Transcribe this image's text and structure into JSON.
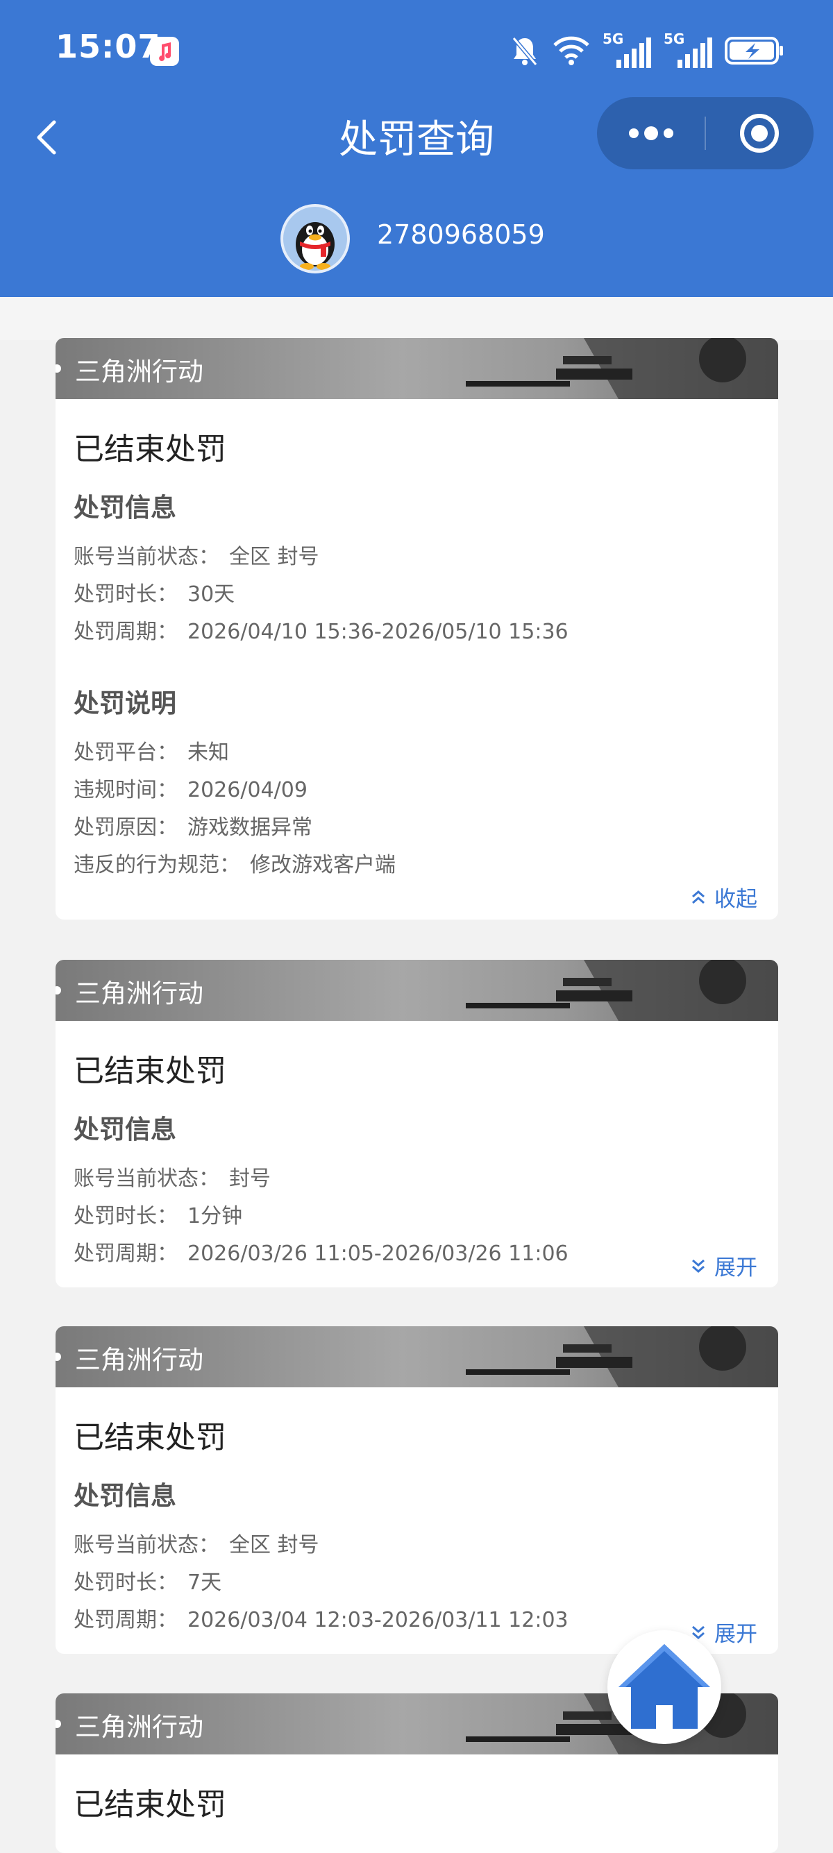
{
  "status_bar": {
    "time": "15:07",
    "network_1": "5G",
    "network_2": "5G"
  },
  "nav": {
    "title": "处罚查询"
  },
  "user": {
    "qq_number": "2780968059"
  },
  "colors": {
    "primary": "#3b78d4",
    "capsule": "#2d61ae",
    "background": "#f2f2f2",
    "card": "#ffffff"
  },
  "records": [
    {
      "game": "三角洲行动",
      "status": "已结束处罚",
      "info_title": "处罚信息",
      "info": [
        {
          "label": "账号当前状态：",
          "value": "全区 封号"
        },
        {
          "label": "处罚时长：",
          "value": "30天"
        },
        {
          "label": "处罚周期：",
          "value": "2026/04/10 15:36-2026/05/10 15:36"
        }
      ],
      "detail_title": "处罚说明",
      "details": [
        {
          "label": "处罚平台：",
          "value": "未知"
        },
        {
          "label": "违规时间：",
          "value": "2026/04/09"
        },
        {
          "label": "处罚原因：",
          "value": "游戏数据异常"
        },
        {
          "label": "违反的行为规范：",
          "value": "修改游戏客户端"
        }
      ],
      "toggle_label": "收起"
    },
    {
      "game": "三角洲行动",
      "status": "已结束处罚",
      "info_title": "处罚信息",
      "info": [
        {
          "label": "账号当前状态：",
          "value": "封号"
        },
        {
          "label": "处罚时长：",
          "value": "1分钟"
        },
        {
          "label": "处罚周期：",
          "value": "2026/03/26 11:05-2026/03/26 11:06"
        }
      ],
      "toggle_label": "展开"
    },
    {
      "game": "三角洲行动",
      "status": "已结束处罚",
      "info_title": "处罚信息",
      "info": [
        {
          "label": "账号当前状态：",
          "value": "全区 封号"
        },
        {
          "label": "处罚时长：",
          "value": "7天"
        },
        {
          "label": "处罚周期：",
          "value": "2026/03/04 12:03-2026/03/11 12:03"
        }
      ],
      "toggle_label": "展开"
    },
    {
      "game": "三角洲行动",
      "status": "已结束处罚"
    }
  ],
  "icons": {
    "back": "chevron-left-icon",
    "more": "more-dots-icon",
    "close": "target-circle-icon",
    "collapse": "double-chevron-up-icon",
    "expand": "double-chevron-down-icon",
    "home": "home-icon",
    "avatar": "qq-penguin-icon"
  }
}
